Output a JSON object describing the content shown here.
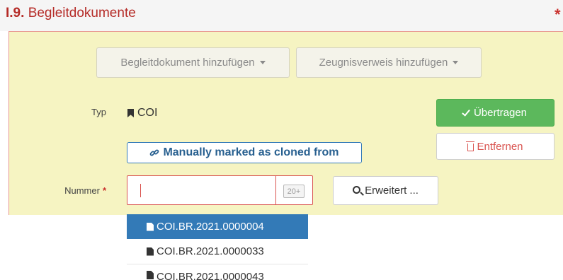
{
  "section": {
    "number": "I.9.",
    "title": "Begleitdokumente",
    "required_marker": "*"
  },
  "toolbar": {
    "add_document_label": "Begleitdokument hinzufügen",
    "add_certificate_ref_label": "Zeugnisverweis hinzufügen"
  },
  "typ": {
    "label": "Typ",
    "value": "COI",
    "icon": "bookmark-icon"
  },
  "actions": {
    "transfer_label": "Übertragen",
    "transfer_icon": "check-icon",
    "remove_label": "Entfernen",
    "remove_icon": "trash-icon"
  },
  "clone_badge": {
    "label": "Manually marked as cloned from",
    "icon": "link-icon"
  },
  "nummer": {
    "label": "Nummer",
    "required_marker": "*",
    "value": "",
    "count_badge": "20+"
  },
  "advanced_search": {
    "label": "Erweitert ...",
    "icon": "search-icon"
  },
  "suggestions": [
    {
      "label": "COI.BR.2021.0000004",
      "active": true,
      "icon": "file-icon"
    },
    {
      "label": "COI.BR.2021.0000033",
      "active": false,
      "icon": "file-icon"
    },
    {
      "label": "COI.BR.2021.0000043",
      "active": false,
      "icon": "file-icon"
    }
  ],
  "colors": {
    "title": "#b52b27",
    "panel_bg": "#f6f4c2",
    "success": "#5cb85c",
    "danger": "#d9534f",
    "primary": "#337ab7"
  }
}
